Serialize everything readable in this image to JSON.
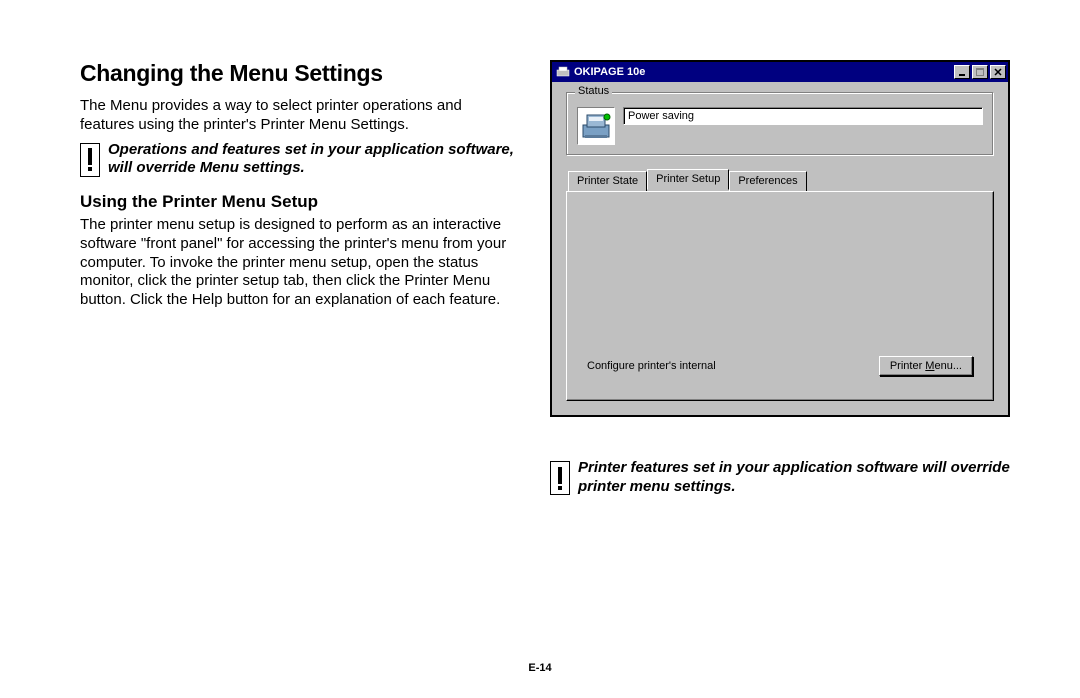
{
  "heading": "Changing the Menu Settings",
  "intro": "The Menu provides a way to select printer operations and features using the printer's Printer Menu Settings.",
  "note1": "Operations and features set in your application software, will override Menu settings.",
  "subheading": "Using the Printer Menu Setup",
  "body2": "The printer menu setup is designed to perform as an interactive software \"front panel\" for accessing the printer's menu from your computer.  To invoke the printer menu setup, open the status monitor, click the printer setup tab, then click the Printer Menu button. Click the Help button for an explanation of each feature.",
  "note2": "Printer features set in your application software will override printer menu settings.",
  "page_number": "E-14",
  "window": {
    "title": "OKIPAGE 10e",
    "status_group_label": "Status",
    "status_value": "Power saving",
    "tabs": {
      "printer_state": "Printer State",
      "printer_setup": "Printer Setup",
      "preferences": "Preferences"
    },
    "panel_text": "Configure printer's internal",
    "button_label_pre": "Printer ",
    "button_label_ul": "M",
    "button_label_post": "enu..."
  }
}
